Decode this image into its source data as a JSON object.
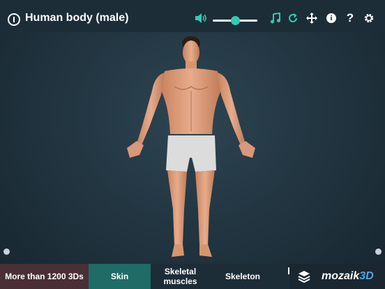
{
  "header": {
    "title": "Human body (male)",
    "volume_level": 0.5
  },
  "colors": {
    "accent": "#34c9b2",
    "background": "#223642",
    "bar": "#1c2d38",
    "more_tab": "#4a2f37",
    "active_tab": "#1f6b66",
    "brand_accent": "#4ea8e0"
  },
  "icons": {
    "info": "info-circle-icon",
    "speaker": "speaker-icon",
    "music": "music-note-icon",
    "reset": "reset-icon",
    "move": "move-arrows-icon",
    "about": "info-icon",
    "help": "question-icon",
    "settings": "gear-icon",
    "layers": "layers-icon"
  },
  "tabs": {
    "more": "More than 1200 3Ds",
    "skin": "Skin",
    "muscles_line1": "Skeletal",
    "muscles_line2": "muscles",
    "skeleton": "Skeleton"
  },
  "brand": {
    "name": "mozaik",
    "suffix": "3D"
  }
}
